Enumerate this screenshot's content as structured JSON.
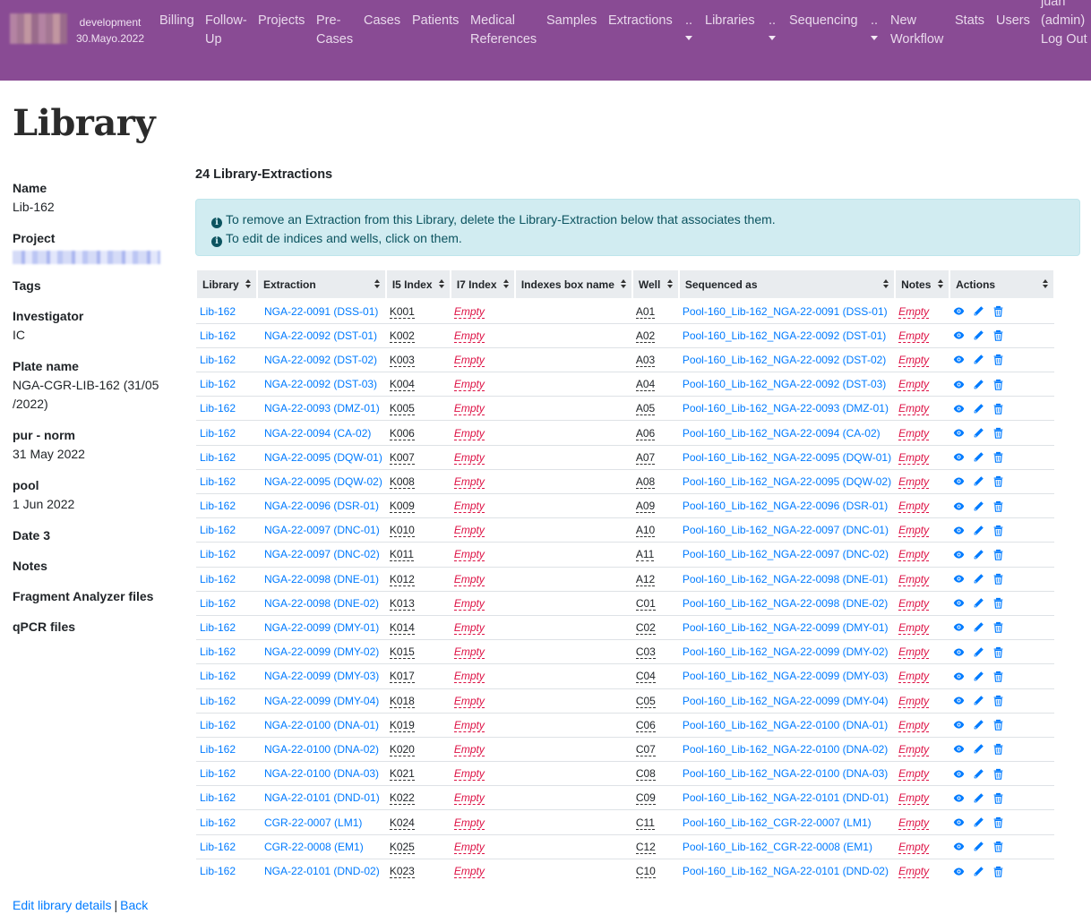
{
  "nav": {
    "env_name": "development",
    "env_date": "30.Mayo.2022",
    "items": [
      {
        "label": "Billing"
      },
      {
        "label": "Follow-Up"
      },
      {
        "label": "Projects"
      },
      {
        "label": "Pre-Cases"
      },
      {
        "label": "Cases"
      },
      {
        "label": "Patients"
      },
      {
        "label": "Medical References"
      },
      {
        "label": "Samples"
      },
      {
        "label": "Extractions"
      },
      {
        "label": ".."
      },
      {
        "label": "Libraries"
      },
      {
        "label": ".."
      },
      {
        "label": "Sequencing"
      },
      {
        "label": ".."
      },
      {
        "label": "New Workflow"
      },
      {
        "label": "Stats"
      },
      {
        "label": "Users"
      },
      {
        "label": "juan (admin) Log Out"
      }
    ]
  },
  "page": {
    "title": "Library"
  },
  "details": {
    "name_label": "Name",
    "name_value": "Lib-162",
    "project_label": "Project",
    "tags_label": "Tags",
    "investigator_label": "Investigator",
    "investigator_value": "IC",
    "plate_label": "Plate name",
    "plate_value": "NGA-CGR-LIB-162 (31/05 /2022)",
    "purnorm_label": "pur - norm",
    "purnorm_value": "31 May 2022",
    "pool_label": "pool",
    "pool_value": "1 Jun 2022",
    "date3_label": "Date 3",
    "notes_label": "Notes",
    "fragment_label": "Fragment Analyzer files",
    "qpcr_label": "qPCR files"
  },
  "footer": {
    "edit_label": "Edit library details",
    "separator": "|",
    "back_label": "Back"
  },
  "section": {
    "title": "24 Library-Extractions"
  },
  "alert": {
    "line1": "To remove an Extraction from this Library, delete the Library-Extraction below that associates them.",
    "line2": "To edit de indices and wells, click on them."
  },
  "table": {
    "headers": [
      "Library",
      "Extraction",
      "I5 Index",
      "I7 Index",
      "Indexes box name",
      "Well",
      "Sequenced as",
      "Notes",
      "Actions"
    ],
    "rows": [
      [
        "Lib-162",
        "NGA-22-0091 (DSS-01)",
        "K001",
        "Empty",
        "",
        "A01",
        "Pool-160_Lib-162_NGA-22-0091 (DSS-01)",
        "Empty"
      ],
      [
        "Lib-162",
        "NGA-22-0092 (DST-01)",
        "K002",
        "Empty",
        "",
        "A02",
        "Pool-160_Lib-162_NGA-22-0092 (DST-01)",
        "Empty"
      ],
      [
        "Lib-162",
        "NGA-22-0092 (DST-02)",
        "K003",
        "Empty",
        "",
        "A03",
        "Pool-160_Lib-162_NGA-22-0092 (DST-02)",
        "Empty"
      ],
      [
        "Lib-162",
        "NGA-22-0092 (DST-03)",
        "K004",
        "Empty",
        "",
        "A04",
        "Pool-160_Lib-162_NGA-22-0092 (DST-03)",
        "Empty"
      ],
      [
        "Lib-162",
        "NGA-22-0093 (DMZ-01)",
        "K005",
        "Empty",
        "",
        "A05",
        "Pool-160_Lib-162_NGA-22-0093 (DMZ-01)",
        "Empty"
      ],
      [
        "Lib-162",
        "NGA-22-0094 (CA-02)",
        "K006",
        "Empty",
        "",
        "A06",
        "Pool-160_Lib-162_NGA-22-0094 (CA-02)",
        "Empty"
      ],
      [
        "Lib-162",
        "NGA-22-0095 (DQW-01)",
        "K007",
        "Empty",
        "",
        "A07",
        "Pool-160_Lib-162_NGA-22-0095 (DQW-01)",
        "Empty"
      ],
      [
        "Lib-162",
        "NGA-22-0095 (DQW-02)",
        "K008",
        "Empty",
        "",
        "A08",
        "Pool-160_Lib-162_NGA-22-0095 (DQW-02)",
        "Empty"
      ],
      [
        "Lib-162",
        "NGA-22-0096 (DSR-01)",
        "K009",
        "Empty",
        "",
        "A09",
        "Pool-160_Lib-162_NGA-22-0096 (DSR-01)",
        "Empty"
      ],
      [
        "Lib-162",
        "NGA-22-0097 (DNC-01)",
        "K010",
        "Empty",
        "",
        "A10",
        "Pool-160_Lib-162_NGA-22-0097 (DNC-01)",
        "Empty"
      ],
      [
        "Lib-162",
        "NGA-22-0097 (DNC-02)",
        "K011",
        "Empty",
        "",
        "A11",
        "Pool-160_Lib-162_NGA-22-0097 (DNC-02)",
        "Empty"
      ],
      [
        "Lib-162",
        "NGA-22-0098 (DNE-01)",
        "K012",
        "Empty",
        "",
        "A12",
        "Pool-160_Lib-162_NGA-22-0098 (DNE-01)",
        "Empty"
      ],
      [
        "Lib-162",
        "NGA-22-0098 (DNE-02)",
        "K013",
        "Empty",
        "",
        "C01",
        "Pool-160_Lib-162_NGA-22-0098 (DNE-02)",
        "Empty"
      ],
      [
        "Lib-162",
        "NGA-22-0099 (DMY-01)",
        "K014",
        "Empty",
        "",
        "C02",
        "Pool-160_Lib-162_NGA-22-0099 (DMY-01)",
        "Empty"
      ],
      [
        "Lib-162",
        "NGA-22-0099 (DMY-02)",
        "K015",
        "Empty",
        "",
        "C03",
        "Pool-160_Lib-162_NGA-22-0099 (DMY-02)",
        "Empty"
      ],
      [
        "Lib-162",
        "NGA-22-0099 (DMY-03)",
        "K017",
        "Empty",
        "",
        "C04",
        "Pool-160_Lib-162_NGA-22-0099 (DMY-03)",
        "Empty"
      ],
      [
        "Lib-162",
        "NGA-22-0099 (DMY-04)",
        "K018",
        "Empty",
        "",
        "C05",
        "Pool-160_Lib-162_NGA-22-0099 (DMY-04)",
        "Empty"
      ],
      [
        "Lib-162",
        "NGA-22-0100 (DNA-01)",
        "K019",
        "Empty",
        "",
        "C06",
        "Pool-160_Lib-162_NGA-22-0100 (DNA-01)",
        "Empty"
      ],
      [
        "Lib-162",
        "NGA-22-0100 (DNA-02)",
        "K020",
        "Empty",
        "",
        "C07",
        "Pool-160_Lib-162_NGA-22-0100 (DNA-02)",
        "Empty"
      ],
      [
        "Lib-162",
        "NGA-22-0100 (DNA-03)",
        "K021",
        "Empty",
        "",
        "C08",
        "Pool-160_Lib-162_NGA-22-0100 (DNA-03)",
        "Empty"
      ],
      [
        "Lib-162",
        "NGA-22-0101 (DND-01)",
        "K022",
        "Empty",
        "",
        "C09",
        "Pool-160_Lib-162_NGA-22-0101 (DND-01)",
        "Empty"
      ],
      [
        "Lib-162",
        "CGR-22-0007 (LM1)",
        "K024",
        "Empty",
        "",
        "C11",
        "Pool-160_Lib-162_CGR-22-0007 (LM1)",
        "Empty"
      ],
      [
        "Lib-162",
        "CGR-22-0008 (EM1)",
        "K025",
        "Empty",
        "",
        "C12",
        "Pool-160_Lib-162_CGR-22-0008 (EM1)",
        "Empty"
      ],
      [
        "Lib-162",
        "NGA-22-0101 (DND-02)",
        "K023",
        "Empty",
        "",
        "C10",
        "Pool-160_Lib-162_NGA-22-0101 (DND-02)",
        "Empty"
      ]
    ],
    "action_icons": [
      "eye-icon",
      "pencil-icon",
      "trash-icon"
    ]
  },
  "colors": {
    "navbar": "#894b94",
    "link": "#007bff",
    "empty": "#dd1144",
    "alert_bg": "#d1ecf1",
    "alert_text": "#0c5460",
    "header_bg": "#e9ecef"
  }
}
